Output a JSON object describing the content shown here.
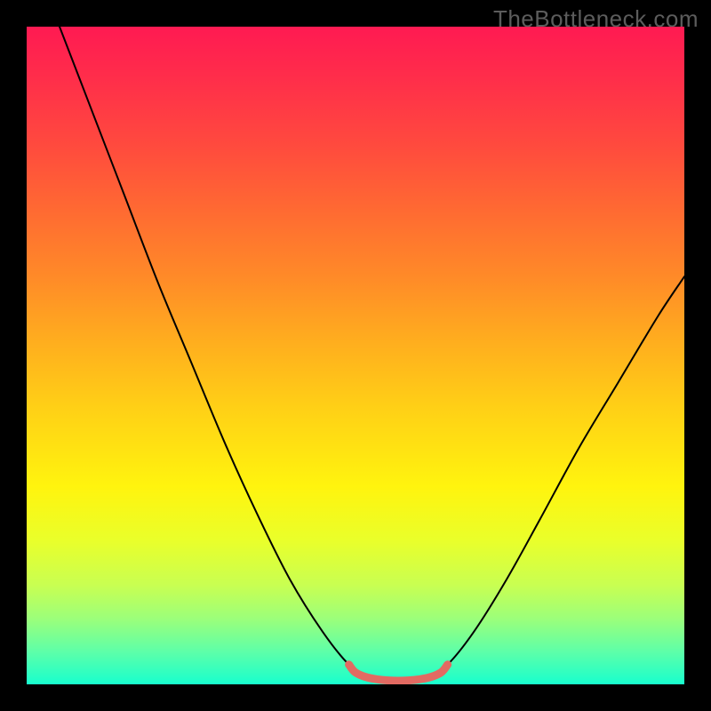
{
  "watermark": "TheBottleneck.com",
  "chart_data": {
    "type": "line",
    "title": "",
    "xlabel": "",
    "ylabel": "",
    "xlim": [
      0,
      100
    ],
    "ylim": [
      0,
      100
    ],
    "gradient_colors": {
      "top": "#ff1a52",
      "mid_upper": "#ff8a28",
      "mid": "#fff40e",
      "mid_lower": "#9cff7a",
      "bottom": "#18ffce"
    },
    "series": [
      {
        "name": "bottleneck-curve",
        "color": "#000000",
        "points": [
          {
            "x": 5,
            "y": 100
          },
          {
            "x": 10,
            "y": 87
          },
          {
            "x": 15,
            "y": 74
          },
          {
            "x": 20,
            "y": 61
          },
          {
            "x": 25,
            "y": 49
          },
          {
            "x": 30,
            "y": 37
          },
          {
            "x": 35,
            "y": 26
          },
          {
            "x": 40,
            "y": 16
          },
          {
            "x": 45,
            "y": 8
          },
          {
            "x": 49,
            "y": 3
          },
          {
            "x": 52,
            "y": 1
          },
          {
            "x": 55,
            "y": 0.5
          },
          {
            "x": 58,
            "y": 0.5
          },
          {
            "x": 61,
            "y": 1
          },
          {
            "x": 64,
            "y": 3
          },
          {
            "x": 68,
            "y": 8
          },
          {
            "x": 73,
            "y": 16
          },
          {
            "x": 78,
            "y": 25
          },
          {
            "x": 84,
            "y": 36
          },
          {
            "x": 90,
            "y": 46
          },
          {
            "x": 96,
            "y": 56
          },
          {
            "x": 100,
            "y": 62
          }
        ]
      },
      {
        "name": "bottom-highlight",
        "color": "#e26a62",
        "points": [
          {
            "x": 49,
            "y": 3
          },
          {
            "x": 50,
            "y": 1.8
          },
          {
            "x": 52,
            "y": 1
          },
          {
            "x": 55,
            "y": 0.6
          },
          {
            "x": 58,
            "y": 0.6
          },
          {
            "x": 61,
            "y": 1
          },
          {
            "x": 63,
            "y": 1.8
          },
          {
            "x": 64,
            "y": 3
          }
        ]
      }
    ]
  }
}
